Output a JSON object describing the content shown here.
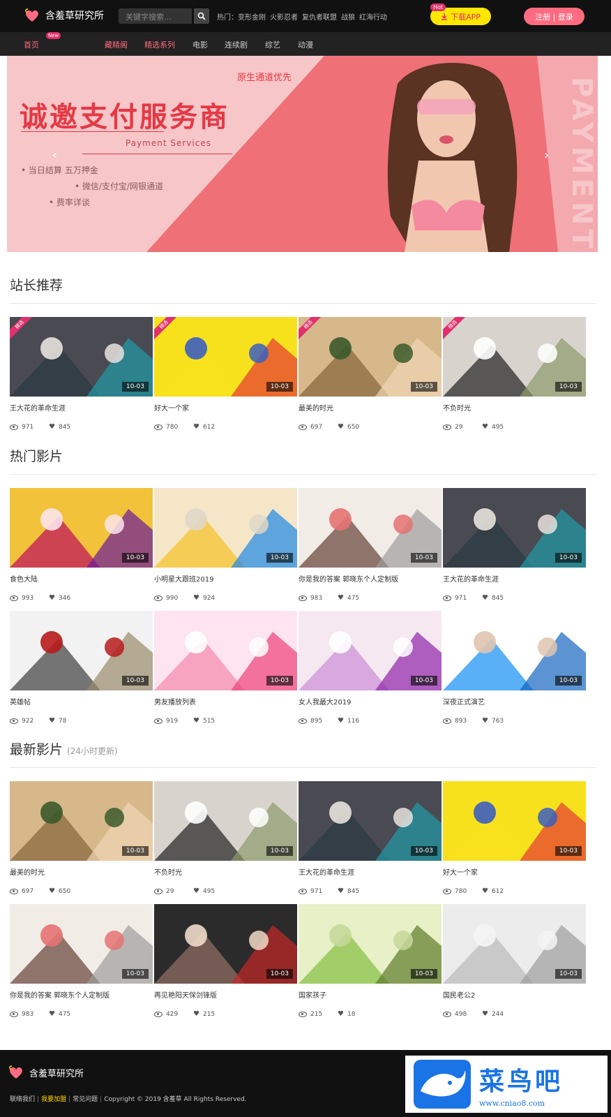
{
  "header": {
    "site_name": "含羞草研究所",
    "search_placeholder": "关键字搜索...",
    "hot_label": "热门：",
    "hot_links": [
      "变形金刚",
      "火影忍者",
      "复仇者联盟",
      "战狼",
      "红海行动"
    ],
    "app_hot_tag": "Hot",
    "app_button": "下载APP",
    "login_button": "注册 | 登录"
  },
  "nav": {
    "new_badge": "New",
    "items": [
      "首页",
      "藏精阁",
      "精选系列",
      "电影",
      "连续剧",
      "综艺",
      "动漫"
    ]
  },
  "banner": {
    "top_text": "原生通道优先",
    "title": "诚邀支付服务商",
    "subtitle": "Payment Services",
    "bullets": [
      "• 当日结算 五万押金",
      "• 微信/支付宝/网银通道",
      "• 费率详谈"
    ],
    "vertical_text": "PAYMENT",
    "slide_count": 5,
    "active_slide": 2
  },
  "sections": [
    {
      "title": "站长推荐",
      "note": "",
      "items": [
        {
          "title": "王大花的革命生涯",
          "date": "10-03",
          "views": "971",
          "likes": "845",
          "badge": "精选",
          "art": "drama1"
        },
        {
          "title": "好大一个家",
          "date": "10-03",
          "views": "780",
          "likes": "612",
          "badge": "精选",
          "art": "family"
        },
        {
          "title": "最美的时光",
          "date": "10-03",
          "views": "697",
          "likes": "650",
          "badge": "精选",
          "art": "besttime"
        },
        {
          "title": "不负时光",
          "date": "10-03",
          "views": "29",
          "likes": "495",
          "badge": "精选",
          "art": "bufu"
        }
      ]
    },
    {
      "title": "热门影片",
      "note": "",
      "items": [
        {
          "title": "食色大陆",
          "date": "10-03",
          "views": "993",
          "likes": "346",
          "badge": "",
          "art": "anime"
        },
        {
          "title": "小明星大跟班2019",
          "date": "10-03",
          "views": "990",
          "likes": "924",
          "badge": "",
          "art": "fashion"
        },
        {
          "title": "你是我的答案 郭晓东个人定制版",
          "date": "10-03",
          "views": "983",
          "likes": "475",
          "badge": "",
          "art": "answer"
        },
        {
          "title": "王大花的革命生涯",
          "date": "10-03",
          "views": "971",
          "likes": "845",
          "badge": "",
          "art": "drama1"
        },
        {
          "title": "英雄帖",
          "date": "10-03",
          "views": "922",
          "likes": "78",
          "badge": "",
          "art": "hero"
        },
        {
          "title": "男友播放列表",
          "date": "10-03",
          "views": "919",
          "likes": "515",
          "badge": "",
          "art": "playlist"
        },
        {
          "title": "女人我最大2019",
          "date": "10-03",
          "views": "895",
          "likes": "116",
          "badge": "",
          "art": "queen"
        },
        {
          "title": "深夜正式演艺",
          "date": "10-03",
          "views": "893",
          "likes": "763",
          "badge": "",
          "art": "night"
        }
      ]
    },
    {
      "title": "最新影片",
      "note": "(24小时更新)",
      "items": [
        {
          "title": "最美的时光",
          "date": "10-03",
          "views": "697",
          "likes": "650",
          "badge": "",
          "art": "besttime"
        },
        {
          "title": "不负时光",
          "date": "10-03",
          "views": "29",
          "likes": "495",
          "badge": "",
          "art": "bufu"
        },
        {
          "title": "王大花的革命生涯",
          "date": "10-03",
          "views": "971",
          "likes": "845",
          "badge": "",
          "art": "drama1"
        },
        {
          "title": "好大一个家",
          "date": "10-03",
          "views": "780",
          "likes": "612",
          "badge": "",
          "art": "family"
        },
        {
          "title": "你是我的答案 郭晓东个人定制版",
          "date": "10-03",
          "views": "983",
          "likes": "475",
          "badge": "",
          "art": "answer"
        },
        {
          "title": "再见艳阳天保剑锋版",
          "date": "10-03",
          "views": "429",
          "likes": "215",
          "badge": "",
          "art": "goodbye"
        },
        {
          "title": "国家孩子",
          "date": "10-03",
          "views": "215",
          "likes": "18",
          "badge": "",
          "art": "country"
        },
        {
          "title": "国民老公2",
          "date": "10-03",
          "views": "498",
          "likes": "244",
          "badge": "",
          "art": "husband"
        }
      ]
    }
  ],
  "footer": {
    "site_name": "含羞草研究所",
    "links": [
      "联络我们",
      "我要加盟",
      "常见问题"
    ],
    "copyright": "Copyright © 2019 含羞草 All Rights Reserved."
  },
  "watermark": {
    "text": "菜鸟吧",
    "url": "www.cniao8.com"
  },
  "colors": {
    "accent": "#ff6b81",
    "header_bg": "#111111",
    "nav_bg": "#222222",
    "app_button": "#ffe600",
    "badge": "#e1306c"
  }
}
